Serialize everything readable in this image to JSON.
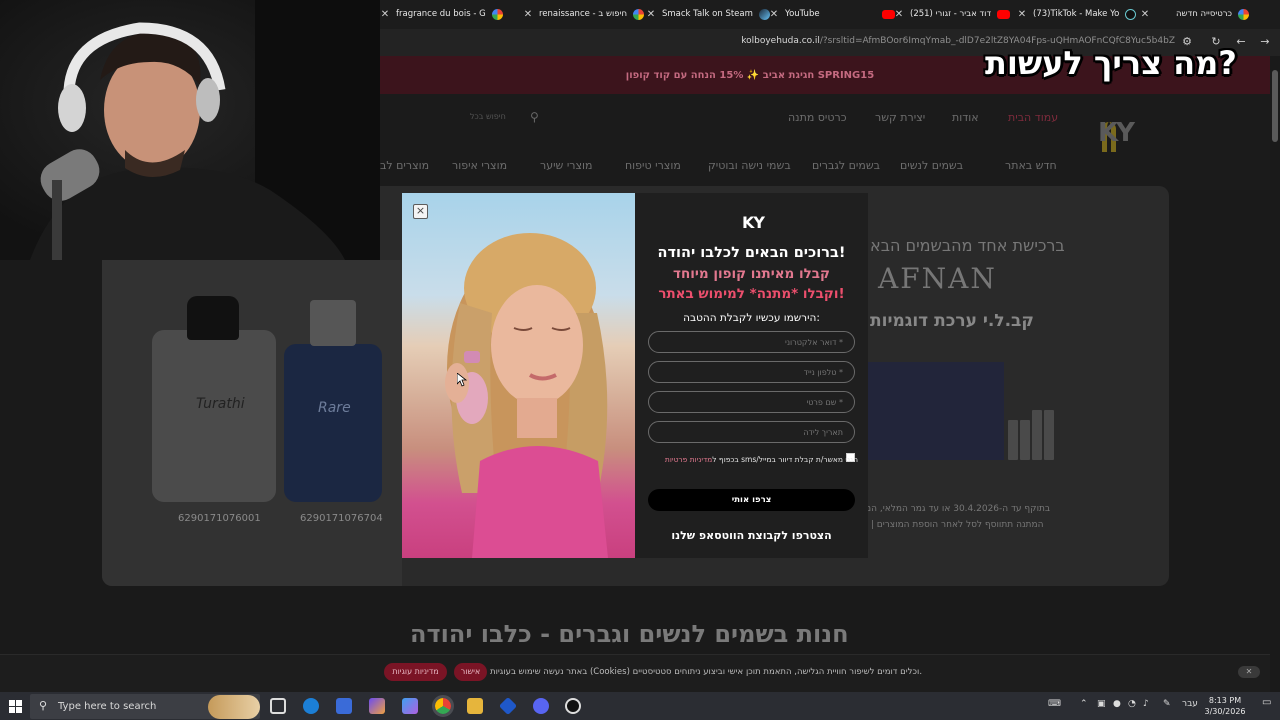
{
  "browser": {
    "tabs": [
      {
        "title": "fragrance du bois - G",
        "icon": "google-icon"
      },
      {
        "title": "renaissance - חיפוש ב",
        "icon": "google-icon"
      },
      {
        "title": "Smack Talk on Steam",
        "icon": "steam-icon"
      },
      {
        "title": "YouTube",
        "icon": "youtube-icon"
      },
      {
        "title": "(251) דוד אביר - זגורי",
        "icon": "youtube-icon"
      },
      {
        "title": "(73)TikTok - Make Yo",
        "icon": "tiktok-icon"
      },
      {
        "title": "כרטיסייה חדשה",
        "icon": "chrome-icon"
      }
    ],
    "url_domain": "kolboyehuda.co.il",
    "url_rest": "/?srsltid=AfmBOor6ImqYmab_-dlD7e2ltZ8YA04Fps-uQHmAOFnCQfC8Yuc5b4bZ"
  },
  "caption": "מה צריך לעשות?",
  "page": {
    "promo_text": "חגיגת אביב ✨ 15% הנחה עם קוד קופון SPRING15",
    "header_nav": [
      "עמוד הבית",
      "אודות",
      "יצירת קשר",
      "כרטיס מתנה"
    ],
    "search_placeholder": "חיפוש בכל",
    "logo": "KY",
    "menu": [
      "חדש באתר",
      "בשמים לנשים",
      "בשמים לגברים",
      "בשמי נישה ובוטיק",
      "מוצרי טיפוח",
      "מוצרי שיער",
      "מוצרי איפור",
      "מוצרים לב"
    ],
    "banner": {
      "line1": "ברכישת אחד מהבשמים הבא",
      "brand": "AFNAN",
      "line3": "קב.ל.י ערכת דוגמיות",
      "fine1": "בתוקף עד ה-30.4.2026 או עד גמר המלאי, המ",
      "fine2": "המתנה תתווסף לסל לאחר הוספת המוצרים | בכ",
      "codes": [
        "6290171076001",
        "6290171076704"
      ],
      "bottle_labels": [
        "Turathi",
        "Rare"
      ]
    },
    "shop_title": "חנות בשמים לנשים וגברים - כלבו יהודה"
  },
  "modal": {
    "close_label": "×",
    "logo": "KY",
    "headline": "ברוכים הבאים לכלבו יהודה!",
    "sub1": "קבלו מאיתנו קופון מיוחד",
    "sub2": "וקבלו *מתנה* למימוש באתר!",
    "register_prompt": "הירשמו עכשיו לקבלת ההטבה:",
    "fields": {
      "email": "דואר אלקטרוני *",
      "phone": "טלפון נייד *",
      "name": "שם פרטי *",
      "birthday": "תאריך לידה"
    },
    "consent_text": "הנני מאשר/ת קבלת דיוור במייל/sms בכפוף ל",
    "consent_link": "מדיניות פרטיות",
    "submit": "צרפו אותי",
    "whatsapp": "הצטרפו לקבוצת הווטסאפ שלנו"
  },
  "cookie": {
    "text": "באתר נעשה שימוש בעוגיות (Cookies) וכלים דומים לשיפור חוויית הגלישה, התאמת תוכן אישי וביצוע ניתוחים סטטיסטיים.",
    "accept": "אישור",
    "policy": "מדיניות עוגיות",
    "close": "✕"
  },
  "taskbar": {
    "search_placeholder": "Type here to search",
    "time": "8:13 PM",
    "date": "3/30/2026",
    "lang": "עבר"
  },
  "colors": {
    "accent_pink": "#ec4f6d",
    "promo_bg": "#3c141c",
    "cookie_btn": "#7a1425"
  }
}
